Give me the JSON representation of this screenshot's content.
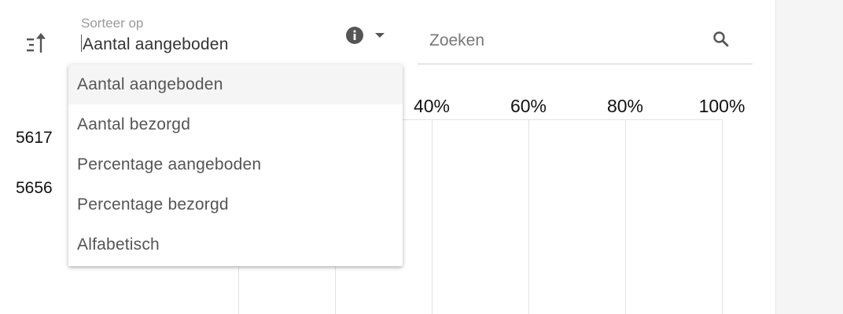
{
  "sort_control": {
    "label": "Sorteer op",
    "value": "Aantal aangeboden",
    "direction_icon": "sort-ascending-icon",
    "info_icon": "info-icon",
    "arrow_icon": "arrow-drop-down-icon"
  },
  "search": {
    "placeholder": "Zoeken",
    "value": "",
    "icon": "search-icon"
  },
  "dropdown": {
    "options": [
      {
        "label": "Aantal aangeboden",
        "selected": true
      },
      {
        "label": "Aantal bezorgd",
        "selected": false
      },
      {
        "label": "Percentage aangeboden",
        "selected": false
      },
      {
        "label": "Percentage bezorgd",
        "selected": false
      },
      {
        "label": "Alfabetisch",
        "selected": false
      }
    ]
  },
  "chart": {
    "axis_ticks": [
      "40%",
      "60%",
      "80%",
      "100%"
    ],
    "row_labels": [
      "5617",
      "5656"
    ]
  },
  "colors": {
    "selected_option_bg": "#f5f5f5",
    "underline": "#7a7a7a",
    "gridline": "#e3e3e3"
  }
}
